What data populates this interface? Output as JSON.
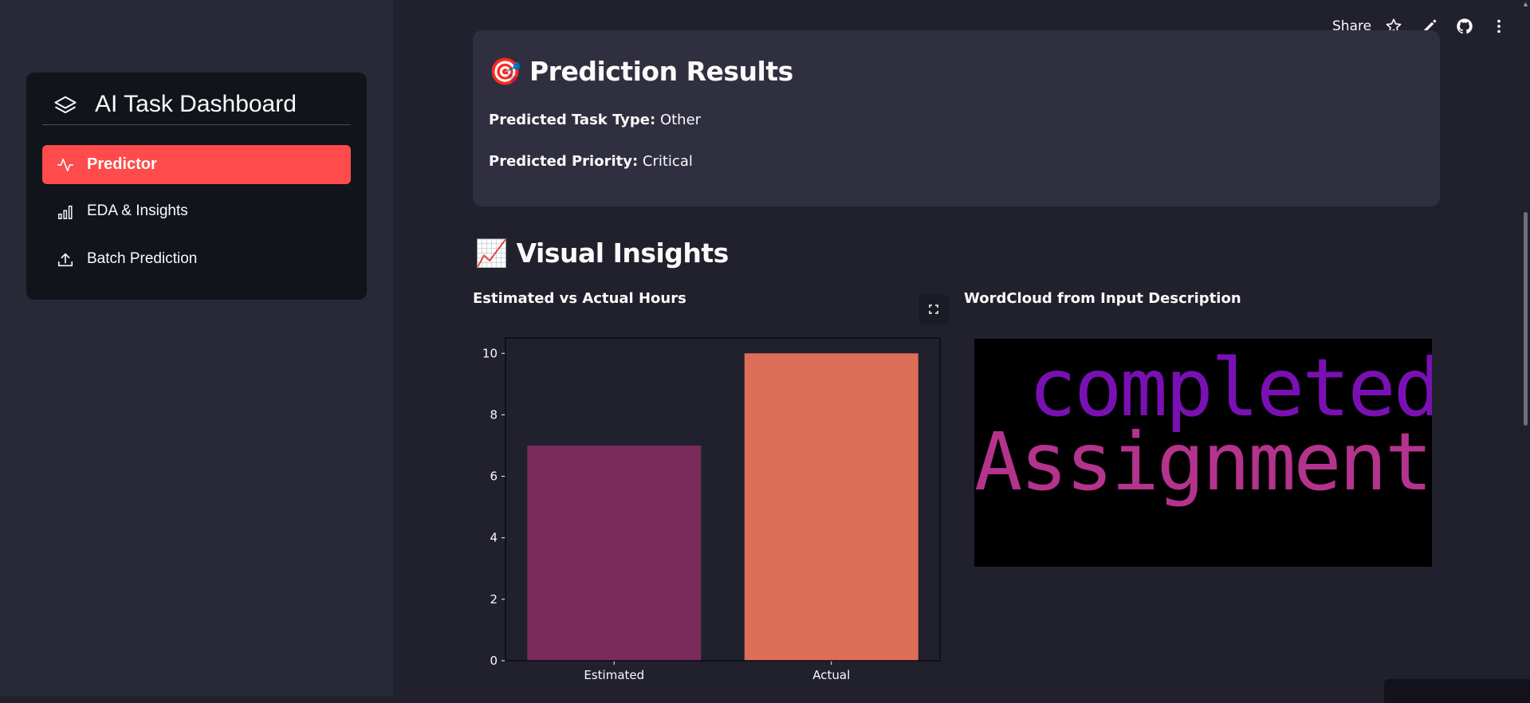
{
  "sidebar": {
    "title": "AI Task Dashboard",
    "items": [
      {
        "label": "Predictor",
        "icon": "activity-icon",
        "active": true
      },
      {
        "label": "EDA & Insights",
        "icon": "bar-chart-icon",
        "active": false
      },
      {
        "label": "Batch Prediction",
        "icon": "upload-icon",
        "active": false
      }
    ]
  },
  "toolbar": {
    "share_label": "Share"
  },
  "prediction": {
    "title": "Prediction Results",
    "title_emoji": "🎯",
    "task_type_label": "Predicted Task Type:",
    "task_type_value": "Other",
    "priority_label": "Predicted Priority:",
    "priority_value": "Critical"
  },
  "visual": {
    "title": "Visual Insights",
    "title_emoji": "📈",
    "chart_title": "Estimated vs Actual Hours",
    "wordcloud_title": "WordCloud from Input Description",
    "wordcloud_words": [
      "completed",
      "Assignment"
    ]
  },
  "colors": {
    "accent": "#ff4b4b",
    "bar_estimated": "#7a2b5c",
    "bar_actual": "#dd6e58",
    "wc_word_1": "#7a10b4",
    "wc_word_2": "#b4338c"
  },
  "chart_data": {
    "type": "bar",
    "categories": [
      "Estimated",
      "Actual"
    ],
    "values": [
      7,
      10
    ],
    "title": "",
    "xlabel": "",
    "ylabel": "",
    "ylim": [
      0,
      10.5
    ],
    "yticks": [
      0,
      2,
      4,
      6,
      8,
      10
    ],
    "grid": false
  }
}
